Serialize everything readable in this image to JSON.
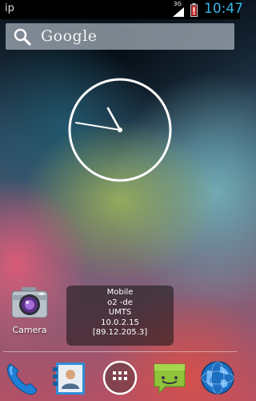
{
  "status_bar": {
    "left_text": "ip",
    "network_type": "3G",
    "time": "10:47",
    "icons": [
      "signal-icon",
      "battery-icon"
    ]
  },
  "search_bar": {
    "label": "Google",
    "icon": "search-icon"
  },
  "clock_widget": {
    "type": "analog-clock",
    "hour": 10,
    "minute": 47
  },
  "home_icons": [
    {
      "label": "Camera",
      "icon": "camera-icon"
    }
  ],
  "network_widget": {
    "lines": [
      "Mobile",
      "o2 -de",
      "UMTS",
      "10.0.2.15",
      "[89.12.205.3]"
    ]
  },
  "dock": [
    {
      "icon": "phone-icon"
    },
    {
      "icon": "contacts-icon"
    },
    {
      "icon": "app-drawer-icon"
    },
    {
      "icon": "messaging-icon"
    },
    {
      "icon": "browser-icon"
    }
  ],
  "colors": {
    "time": "#33b5e5",
    "status_bar_bg": "#000000",
    "battery_red": "#d12a2a",
    "messaging_green": "#99cc33"
  }
}
